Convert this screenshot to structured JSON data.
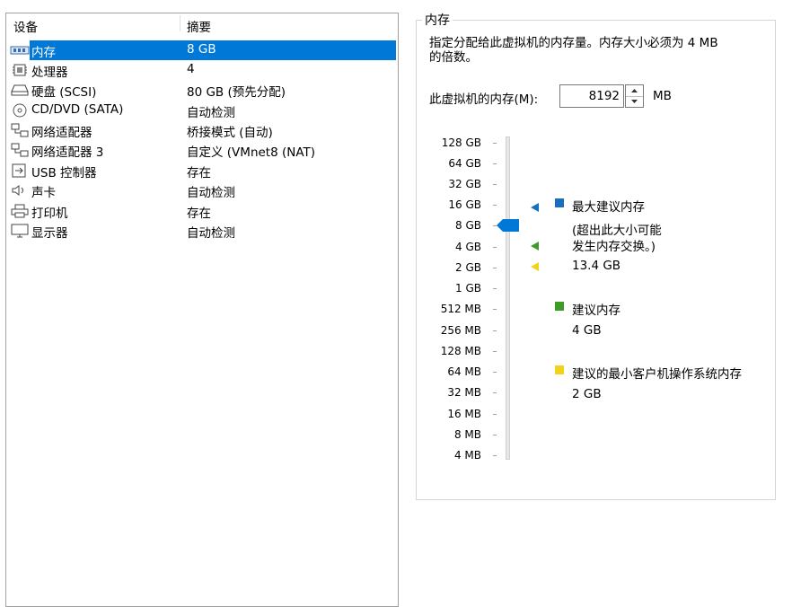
{
  "device_list": {
    "header": {
      "device": "设备",
      "summary": "摘要"
    },
    "items": [
      {
        "icon": "memory-icon",
        "name": "内存",
        "summary": "8 GB",
        "selected": true
      },
      {
        "icon": "processor-icon",
        "name": "处理器",
        "summary": "4"
      },
      {
        "icon": "disk-icon",
        "name": "硬盘 (SCSI)",
        "summary": "80 GB (预先分配)"
      },
      {
        "icon": "cd-icon",
        "name": "CD/DVD (SATA)",
        "summary": "自动检测"
      },
      {
        "icon": "network-icon",
        "name": "网络适配器",
        "summary": "桥接模式 (自动)"
      },
      {
        "icon": "network-icon",
        "name": "网络适配器 3",
        "summary": "自定义 (VMnet8 (NAT)"
      },
      {
        "icon": "usb-icon",
        "name": "USB 控制器",
        "summary": "存在"
      },
      {
        "icon": "speaker-icon",
        "name": "声卡",
        "summary": "自动检测"
      },
      {
        "icon": "printer-icon",
        "name": "打印机",
        "summary": "存在"
      },
      {
        "icon": "display-icon",
        "name": "显示器",
        "summary": "自动检测"
      }
    ]
  },
  "memory": {
    "group_title": "内存",
    "description_line1": "指定分配给此虚拟机的内存量。内存大小必须为 4 MB",
    "description_line2": "的倍数。",
    "input_label": "此虚拟机的内存(M):",
    "value": "8192",
    "unit": "MB",
    "scale_labels": [
      "128 GB",
      "64 GB",
      "32 GB",
      "16 GB",
      "8 GB",
      "4 GB",
      "2 GB",
      "1 GB",
      "512 MB",
      "256 MB",
      "128 MB",
      "64 MB",
      "32 MB",
      "16 MB",
      "8 MB",
      "4 MB"
    ],
    "current_level": "8 GB",
    "legend": {
      "max": {
        "label": "最大建议内存",
        "note_line1": "(超出此大小可能",
        "note_line2": "发生内存交换。)",
        "value": "13.4 GB",
        "color": "#1a6fbd",
        "level": "16 GB"
      },
      "recommended": {
        "label": "建议内存",
        "value": "4 GB",
        "color": "#3f9b27",
        "level": "4 GB"
      },
      "min_guest": {
        "label": "建议的最小客户机操作系统内存",
        "value": "2 GB",
        "color": "#f2d21b",
        "level": "2 GB"
      }
    },
    "thumb_color": "#0078d7"
  }
}
